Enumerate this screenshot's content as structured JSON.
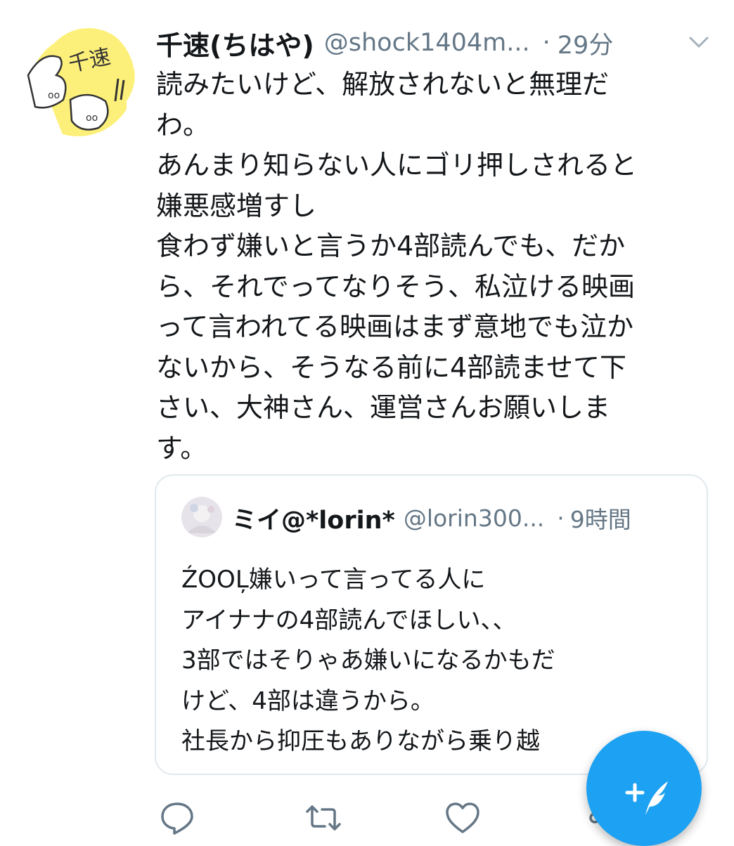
{
  "tweet": {
    "display_name": "千速(ちはや)",
    "handle": "@shock1404m...",
    "separator": "·",
    "time": "29分",
    "avatar_text": "千速",
    "text_lines": [
      "読みたいけど、解放されないと無理だ",
      "わ。",
      "あんまり知らない人にゴリ押しされると",
      "嫌悪感増すし",
      "食わず嫌いと言うか4部読んでも、だか",
      "ら、それでってなりそう、私泣ける映画",
      "って言われてる映画はまず意地でも泣か",
      "ないから、そうなる前に4部読ませて下",
      "さい、大神さん、運営さんお願いしま",
      "す。"
    ]
  },
  "quoted_tweet": {
    "display_name": "ミイ@*lorin*",
    "handle": "@lorin300...",
    "separator": "·",
    "time": "9時間",
    "text_lines": [
      "ŹOOĻ嫌いって言ってる人に",
      "アイナナの4部読んでほしい、、",
      "3部ではそりゃあ嫌いになるかもだ",
      "けど、4部は違うから。",
      "社長から抑圧もありながら乗り越"
    ]
  },
  "actions": {
    "reply_icon": "reply-icon",
    "retweet_icon": "retweet-icon",
    "like_icon": "heart-icon",
    "share_icon": "share-icon"
  },
  "fab": {
    "icon": "compose-tweet-icon"
  },
  "colors": {
    "text": "#14171a",
    "secondary_text": "#657786",
    "border": "#e1e8ed",
    "accent": "#1da1f2",
    "avatar_bg": "#fdf07a"
  }
}
